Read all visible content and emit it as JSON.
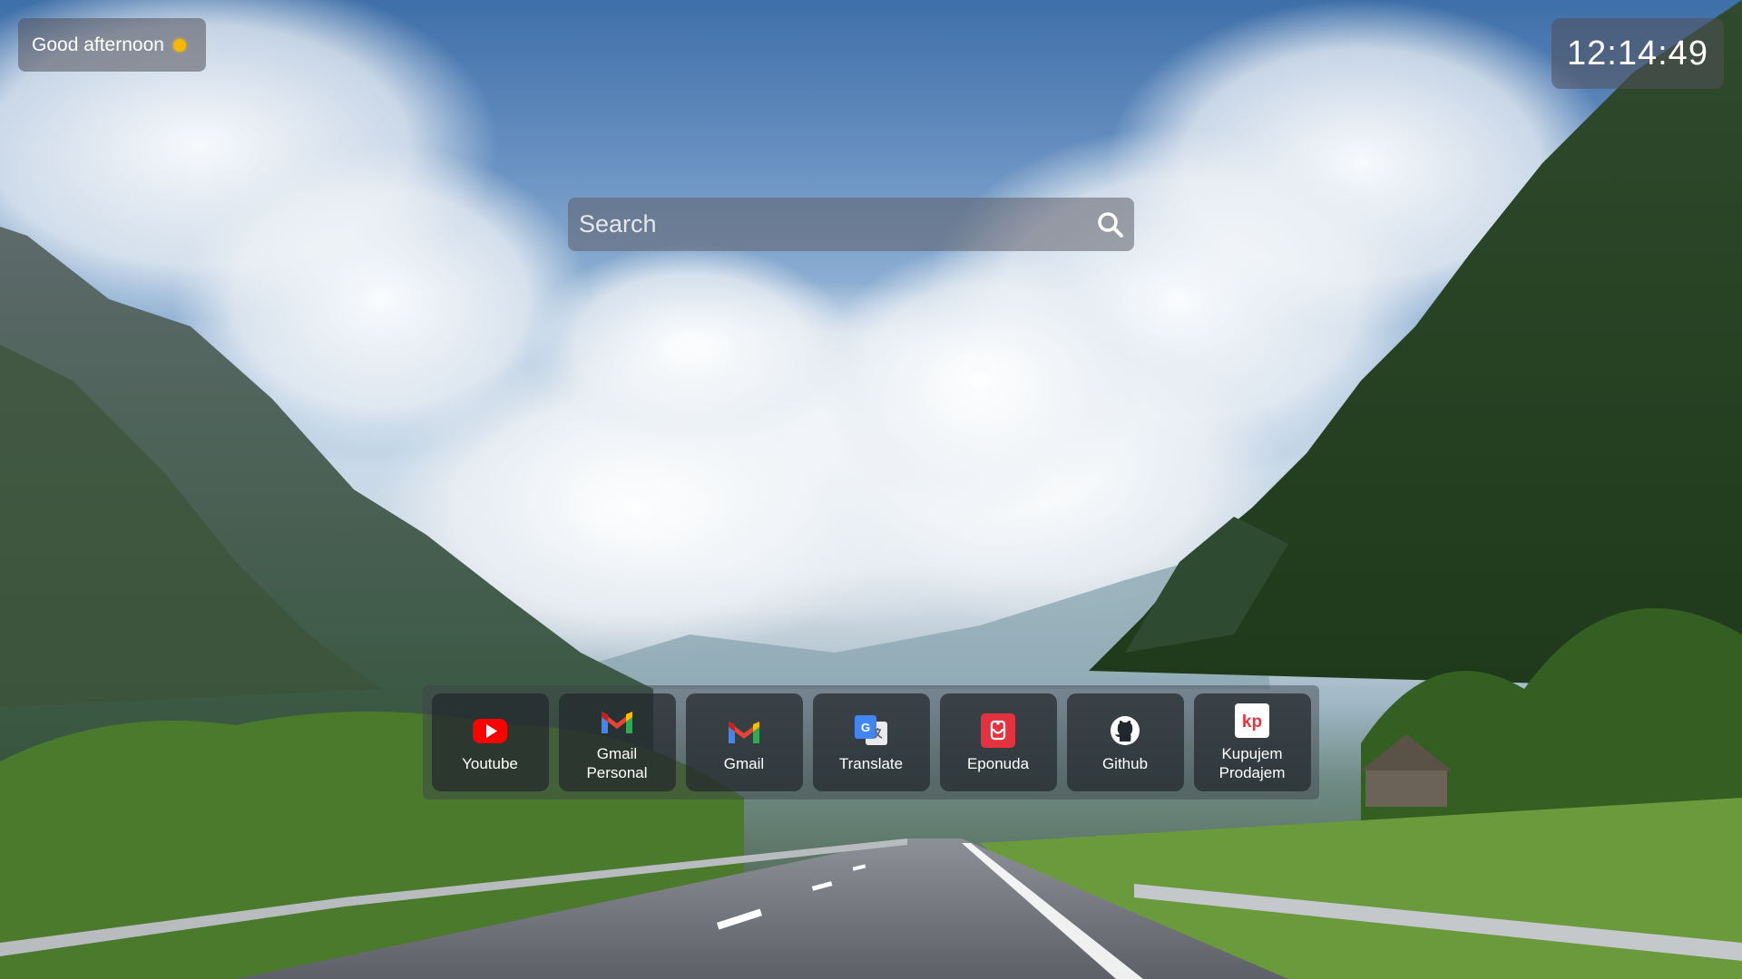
{
  "greeting": {
    "text": "Good afternoon",
    "indicator_color": "#f5b800"
  },
  "clock": {
    "time": "12:14:49"
  },
  "search": {
    "placeholder": "Search"
  },
  "shortcuts": [
    {
      "label": "Youtube",
      "icon": "youtube-icon"
    },
    {
      "label": "Gmail Personal",
      "icon": "gmail-icon"
    },
    {
      "label": "Gmail",
      "icon": "gmail-icon"
    },
    {
      "label": "Translate",
      "icon": "google-translate-icon"
    },
    {
      "label": "Eponuda",
      "icon": "eponuda-icon"
    },
    {
      "label": "Github",
      "icon": "github-icon"
    },
    {
      "label": "Kupujem Prodajem",
      "icon": "kupujem-prodajem-icon",
      "logo_text": "kp"
    }
  ],
  "colors": {
    "youtube": "#ff0000",
    "gmail_red": "#ea4335",
    "gmail_blue": "#4285f4",
    "gmail_green": "#34a853",
    "gmail_yellow": "#fbbc04",
    "eponuda": "#e5323f"
  }
}
